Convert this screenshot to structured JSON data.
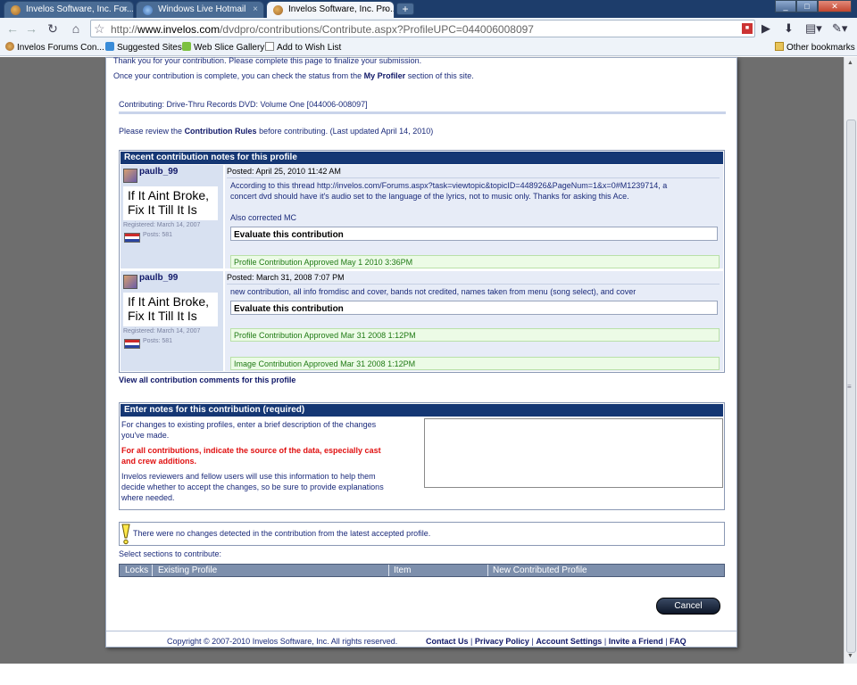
{
  "browser": {
    "tabs": [
      {
        "title": "Invelos Software, Inc. For...",
        "close": "×"
      },
      {
        "title": "Windows Live Hotmail",
        "close": "×"
      },
      {
        "title": "Invelos Software, Inc. Pro...",
        "close": "×"
      }
    ],
    "new_tab": "+",
    "window_buttons": {
      "min": "_",
      "max": "□",
      "close": "✕"
    },
    "url_prefix": "http://",
    "url_host": "www.invelos.com",
    "url_path": "/dvdpro/contributions/Contribute.aspx?ProfileUPC=044006008097",
    "bookmarks": [
      "Invelos Forums Con...",
      "Suggested Sites",
      "Web Slice Gallery",
      "Add to Wish List"
    ],
    "other_bookmarks": "Other bookmarks"
  },
  "page": {
    "intro1": "Thank you for your contribution. Please complete this page to finalize your submission.",
    "intro2_pre": "Once your contribution is complete, you can check the status from the",
    "intro2_link": "My Profiler",
    "intro2_post": "section of this site.",
    "contributing": "Contributing: Drive-Thru Records DVD: Volume One [044006-008097]",
    "rules_pre": "Please review the",
    "rules_link": "Contribution Rules",
    "rules_post": "before contributing. (Last updated April 14, 2010)",
    "notes_header": "Recent contribution notes for this profile",
    "posts": [
      {
        "user": "paulb_99",
        "sig1": "If It Aint Broke,",
        "sig2": "Fix It Till It Is",
        "registered": "Registered: March 14, 2007",
        "posts": "Posts: 581",
        "posted": "Posted: April 25, 2010 11:42 AM",
        "body1": "According to this thread http://invelos.com/Forums.aspx?task=viewtopic&topicID=448926&PageNum=1&x=0#M1239714, a",
        "body2": "concert dvd should have it's audio set to the language of the lyrics, not to music only. Thanks for asking this Ace.",
        "body3": "Also corrected MC",
        "evaluate": "Evaluate this contribution",
        "status1": "Profile Contribution Approved May  1 2010  3:36PM"
      },
      {
        "user": "paulb_99",
        "sig1": "If It Aint Broke,",
        "sig2": "Fix It Till It Is",
        "registered": "Registered: March 14, 2007",
        "posts": "Posts: 581",
        "posted": "Posted: March 31, 2008 7:07 PM",
        "body1": "new contribution, all info fromdisc and cover, bands not credited, names taken from menu (song select), and cover",
        "evaluate": "Evaluate this contribution",
        "status1": "Profile Contribution Approved Mar 31 2008  1:12PM",
        "status2": "Image Contribution Approved Mar 31 2008  1:12PM"
      }
    ],
    "view_all": "View all contribution comments for this profile",
    "enter_header": "Enter notes for this contribution (required)",
    "instr1a": "For changes to existing profiles, enter a brief description of the changes",
    "instr1b": "you've made.",
    "instr2a": "For all contributions, indicate the source of the data, especially cast",
    "instr2b": "and crew additions.",
    "instr3a": "Invelos reviewers and fellow users will use this information to help them",
    "instr3b": "decide whether to accept the changes, so be sure to provide explanations",
    "instr3c": "where needed.",
    "warning": "There were no changes detected in the contribution from the latest accepted profile.",
    "select_sections": "Select sections to contribute:",
    "table_headers": [
      "Locks",
      "Existing Profile",
      "Item",
      "New Contributed Profile"
    ],
    "cancel": "Cancel",
    "copyright": "Copyright © 2007-2010 Invelos Software, Inc. All rights reserved.",
    "footer_links": [
      "Contact Us",
      "Privacy Policy",
      "Account Settings",
      "Invite a Friend",
      "FAQ"
    ],
    "footer_sep": "|"
  },
  "colors": {
    "header_bar": "#153774",
    "link": "#101868",
    "warning_red": "#e01010",
    "approved_green": "#1f7a14"
  }
}
